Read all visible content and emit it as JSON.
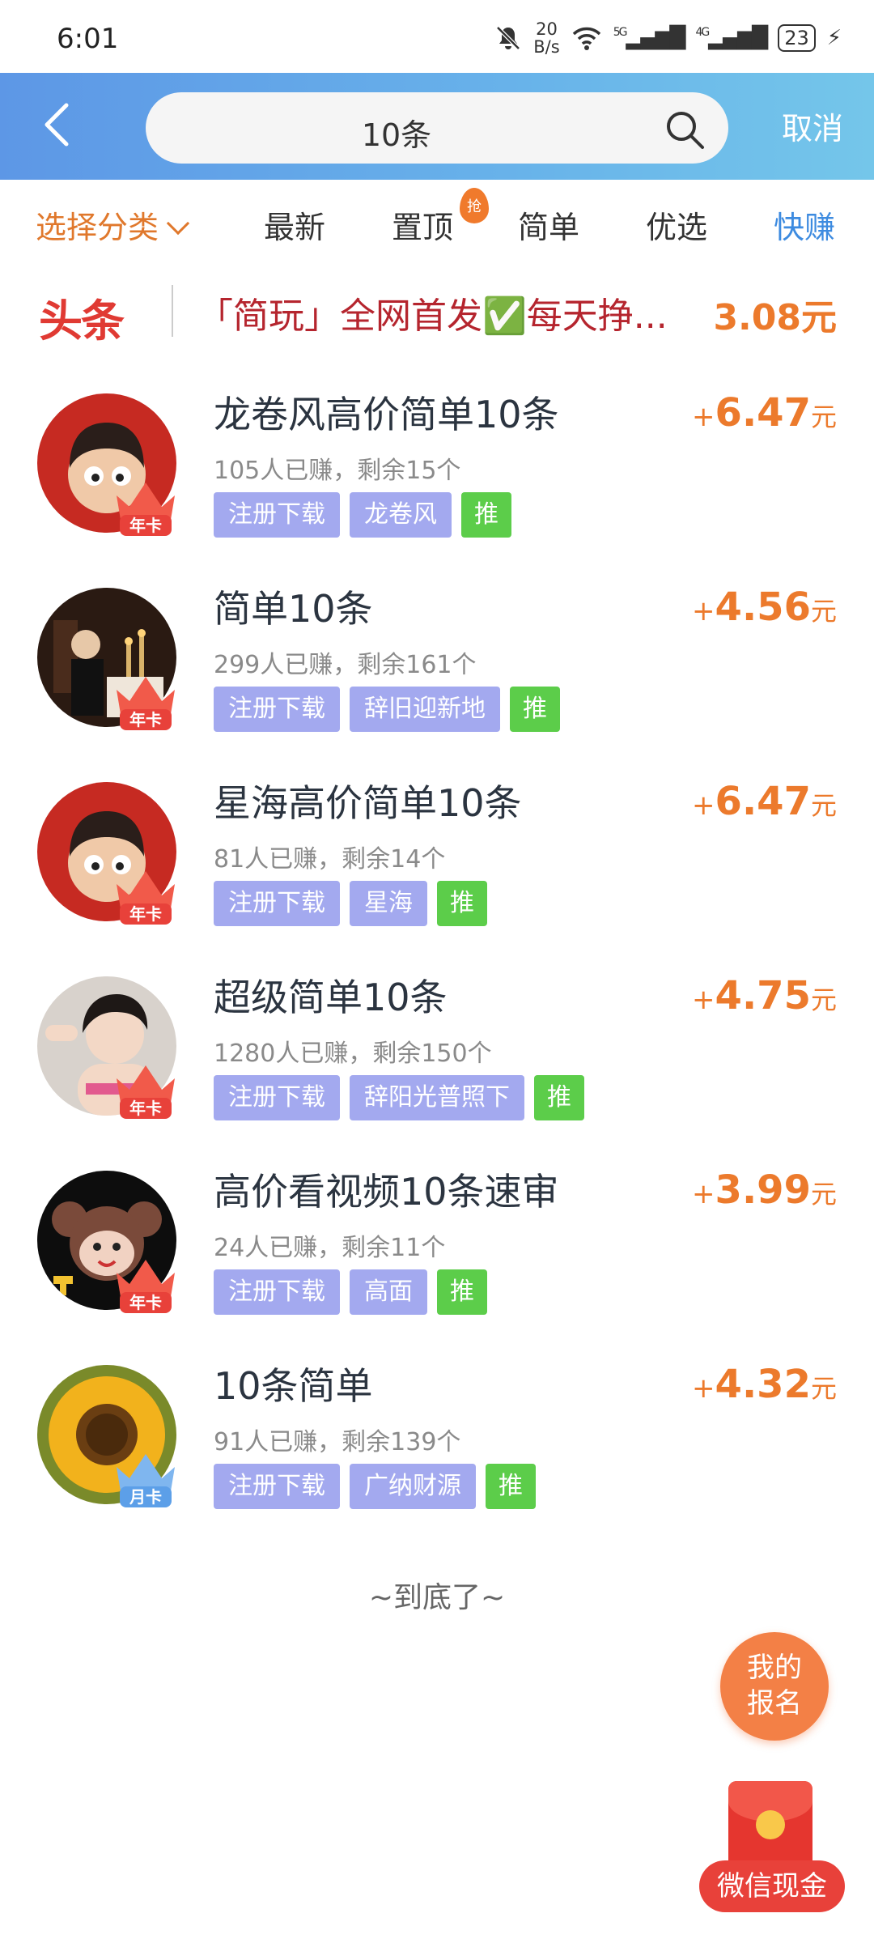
{
  "status": {
    "time": "6:01",
    "net_speed_top": "20",
    "net_speed_bottom": "B/s",
    "signal_5g": "5G",
    "signal_4g": "4G",
    "battery": "23"
  },
  "header": {
    "search_value": "10条",
    "cancel_label": "取消"
  },
  "categories": {
    "select_label": "选择分类",
    "items": [
      "最新",
      "置顶",
      "简单",
      "优选",
      "快赚"
    ],
    "hot_badge": "抢"
  },
  "headline": {
    "tag": "头条",
    "text": "「简玩」全网首发✅每天挣...",
    "reward": "3.08元"
  },
  "tasks": [
    {
      "title": "龙卷风高价简单10条",
      "meta": "105人已赚，剩余15个",
      "tags": [
        "注册下载",
        "龙卷风"
      ],
      "tui": "推",
      "plus": "+",
      "amount": "6.47",
      "unit": "元",
      "badge": "年卡"
    },
    {
      "title": "简单10条",
      "meta": "299人已赚，剩余161个",
      "tags": [
        "注册下载",
        "辞旧迎新地"
      ],
      "tui": "推",
      "plus": "+",
      "amount": "4.56",
      "unit": "元",
      "badge": "年卡"
    },
    {
      "title": "星海高价简单10条",
      "meta": "81人已赚，剩余14个",
      "tags": [
        "注册下载",
        "星海"
      ],
      "tui": "推",
      "plus": "+",
      "amount": "6.47",
      "unit": "元",
      "badge": "年卡"
    },
    {
      "title": "超级简单10条",
      "meta": "1280人已赚，剩余150个",
      "tags": [
        "注册下载",
        "辞阳光普照下"
      ],
      "tui": "推",
      "plus": "+",
      "amount": "4.75",
      "unit": "元",
      "badge": "年卡"
    },
    {
      "title": "高价看视频10条速审",
      "meta": "24人已赚，剩余11个",
      "tags": [
        "注册下载",
        "高面"
      ],
      "tui": "推",
      "plus": "+",
      "amount": "3.99",
      "unit": "元",
      "badge": "年卡"
    },
    {
      "title": "10条简单",
      "meta": "91人已赚，剩余139个",
      "tags": [
        "注册下载",
        "广纳财源"
      ],
      "tui": "推",
      "plus": "+",
      "amount": "4.32",
      "unit": "元",
      "badge": "月卡"
    }
  ],
  "end_text": "~到底了~",
  "float": {
    "my_signup_line1": "我的",
    "my_signup_line2": "报名",
    "wechat_cash": "微信现金"
  },
  "colors": {
    "accent_orange": "#ec7a2c",
    "header_blue": "#5d97e6",
    "tag_purple": "#a3a9ef",
    "tag_green": "#5ccd4a",
    "headline_red": "#e03a33"
  }
}
